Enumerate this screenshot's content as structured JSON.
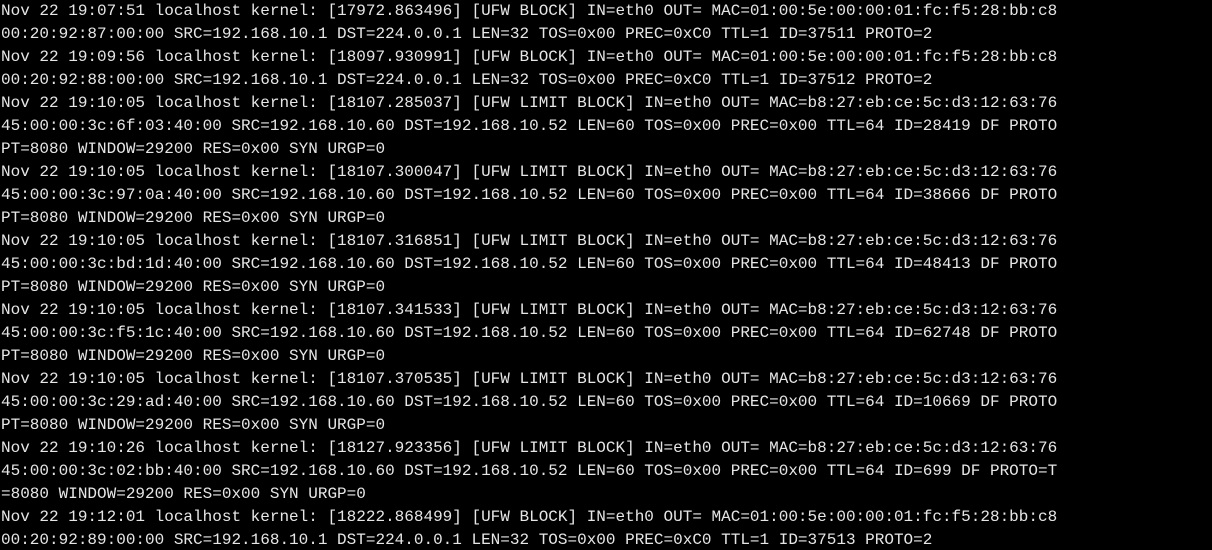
{
  "terminal": {
    "colors": {
      "background": "#000000",
      "text": "#e6e6e6"
    },
    "lines": [
      "Nov 22 19:07:51 localhost kernel: [17972.863496] [UFW BLOCK] IN=eth0 OUT= MAC=01:00:5e:00:00:01:fc:f5:28:bb:c8",
      "00:20:92:87:00:00 SRC=192.168.10.1 DST=224.0.0.1 LEN=32 TOS=0x00 PREC=0xC0 TTL=1 ID=37511 PROTO=2",
      "Nov 22 19:09:56 localhost kernel: [18097.930991] [UFW BLOCK] IN=eth0 OUT= MAC=01:00:5e:00:00:01:fc:f5:28:bb:c8",
      "00:20:92:88:00:00 SRC=192.168.10.1 DST=224.0.0.1 LEN=32 TOS=0x00 PREC=0xC0 TTL=1 ID=37512 PROTO=2",
      "Nov 22 19:10:05 localhost kernel: [18107.285037] [UFW LIMIT BLOCK] IN=eth0 OUT= MAC=b8:27:eb:ce:5c:d3:12:63:76",
      "45:00:00:3c:6f:03:40:00 SRC=192.168.10.60 DST=192.168.10.52 LEN=60 TOS=0x00 PREC=0x00 TTL=64 ID=28419 DF PROTO",
      "PT=8080 WINDOW=29200 RES=0x00 SYN URGP=0",
      "Nov 22 19:10:05 localhost kernel: [18107.300047] [UFW LIMIT BLOCK] IN=eth0 OUT= MAC=b8:27:eb:ce:5c:d3:12:63:76",
      "45:00:00:3c:97:0a:40:00 SRC=192.168.10.60 DST=192.168.10.52 LEN=60 TOS=0x00 PREC=0x00 TTL=64 ID=38666 DF PROTO",
      "PT=8080 WINDOW=29200 RES=0x00 SYN URGP=0",
      "Nov 22 19:10:05 localhost kernel: [18107.316851] [UFW LIMIT BLOCK] IN=eth0 OUT= MAC=b8:27:eb:ce:5c:d3:12:63:76",
      "45:00:00:3c:bd:1d:40:00 SRC=192.168.10.60 DST=192.168.10.52 LEN=60 TOS=0x00 PREC=0x00 TTL=64 ID=48413 DF PROTO",
      "PT=8080 WINDOW=29200 RES=0x00 SYN URGP=0",
      "Nov 22 19:10:05 localhost kernel: [18107.341533] [UFW LIMIT BLOCK] IN=eth0 OUT= MAC=b8:27:eb:ce:5c:d3:12:63:76",
      "45:00:00:3c:f5:1c:40:00 SRC=192.168.10.60 DST=192.168.10.52 LEN=60 TOS=0x00 PREC=0x00 TTL=64 ID=62748 DF PROTO",
      "PT=8080 WINDOW=29200 RES=0x00 SYN URGP=0",
      "Nov 22 19:10:05 localhost kernel: [18107.370535] [UFW LIMIT BLOCK] IN=eth0 OUT= MAC=b8:27:eb:ce:5c:d3:12:63:76",
      "45:00:00:3c:29:ad:40:00 SRC=192.168.10.60 DST=192.168.10.52 LEN=60 TOS=0x00 PREC=0x00 TTL=64 ID=10669 DF PROTO",
      "PT=8080 WINDOW=29200 RES=0x00 SYN URGP=0",
      "Nov 22 19:10:26 localhost kernel: [18127.923356] [UFW LIMIT BLOCK] IN=eth0 OUT= MAC=b8:27:eb:ce:5c:d3:12:63:76",
      "45:00:00:3c:02:bb:40:00 SRC=192.168.10.60 DST=192.168.10.52 LEN=60 TOS=0x00 PREC=0x00 TTL=64 ID=699 DF PROTO=T",
      "=8080 WINDOW=29200 RES=0x00 SYN URGP=0",
      "Nov 22 19:12:01 localhost kernel: [18222.868499] [UFW BLOCK] IN=eth0 OUT= MAC=01:00:5e:00:00:01:fc:f5:28:bb:c8",
      "00:20:92:89:00:00 SRC=192.168.10.1 DST=224.0.0.1 LEN=32 TOS=0x00 PREC=0xC0 TTL=1 ID=37513 PROTO=2"
    ]
  }
}
